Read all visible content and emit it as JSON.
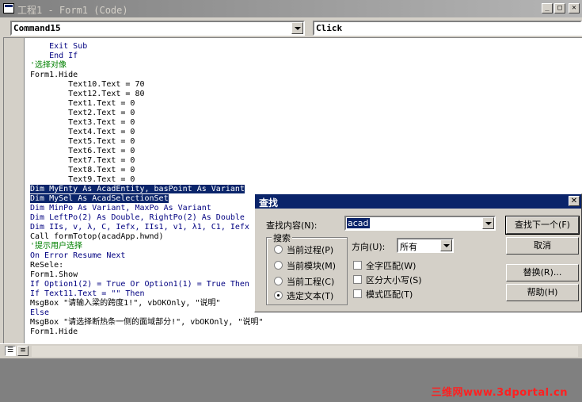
{
  "window": {
    "title": "工程1 - Form1 (Code)",
    "min_icon": "minimize-icon",
    "max_icon": "maximize-icon",
    "close_icon": "close-icon"
  },
  "object_combo": {
    "value": "Command15"
  },
  "proc_combo": {
    "value": "Click"
  },
  "code_lines": [
    {
      "t": "    Exit Sub",
      "c": "kw"
    },
    {
      "t": "    End If",
      "c": "kw"
    },
    {
      "t": "'选择对像",
      "c": "cm"
    },
    {
      "t": "Form1.Hide",
      "c": "tx"
    },
    {
      "t": "        Text10.Text = 70",
      "c": "tx"
    },
    {
      "t": "        Text12.Text = 80",
      "c": "tx"
    },
    {
      "t": "        Text1.Text = 0",
      "c": "tx"
    },
    {
      "t": "        Text2.Text = 0",
      "c": "tx"
    },
    {
      "t": "        Text3.Text = 0",
      "c": "tx"
    },
    {
      "t": "        Text4.Text = 0",
      "c": "tx"
    },
    {
      "t": "        Text5.Text = 0",
      "c": "tx"
    },
    {
      "t": "        Text6.Text = 0",
      "c": "tx"
    },
    {
      "t": "        Text7.Text = 0",
      "c": "tx"
    },
    {
      "t": "        Text8.Text = 0",
      "c": "tx"
    },
    {
      "t": "        Text9.Text = 0",
      "c": "tx"
    },
    {
      "t": "Dim MyEnty As AcadEntity, basPoint As Variant",
      "c": "hl"
    },
    {
      "t": "Dim MySel As AcadSelectionSet",
      "c": "hl"
    },
    {
      "t": "Dim MinPo As Variant, MaxPo As Variant",
      "c": "kw"
    },
    {
      "t": "Dim LeftPo(2) As Double, RightPo(2) As Double",
      "c": "kw"
    },
    {
      "t": "Dim IIs, v, λ, C, Iefx, IIs1, v1, λ1, C1, Iefx",
      "c": "kw"
    },
    {
      "t": "Call formTotop(acadApp.hwnd)",
      "c": "tx"
    },
    {
      "t": "'提示用户选择",
      "c": "cm"
    },
    {
      "t": "On Error Resume Next",
      "c": "kw"
    },
    {
      "t": "ReSele:",
      "c": "tx"
    },
    {
      "t": "Form1.Show",
      "c": "tx"
    },
    {
      "t": "If Option1(2) = True Or Option1(1) = True Then",
      "c": "kw"
    },
    {
      "t": "If Text11.Text = \"\" Then",
      "c": "kw"
    },
    {
      "t": "MsgBox \"请输入梁的跨度1!\", vbOKOnly, \"说明\"",
      "c": "tx"
    },
    {
      "t": "Else",
      "c": "kw"
    },
    {
      "t": "MsgBox \"请选择断热条一侧的面域部分!\", vbOKOnly, \"说明\"",
      "c": "tx"
    },
    {
      "t": "Form1.Hide",
      "c": "tx"
    }
  ],
  "dialog": {
    "title": "查找",
    "find_label": "查找内容(N):",
    "find_value": "acad",
    "direction_label": "方向(U):",
    "direction_value": "所有",
    "search_group": "搜索",
    "radios": [
      "当前过程(P)",
      "当前模块(M)",
      "当前工程(C)",
      "选定文本(T)"
    ],
    "selected_radio": 3,
    "checks": [
      "全字匹配(W)",
      "区分大小写(S)",
      "模式匹配(T)"
    ],
    "buttons": [
      "查找下一个(F)",
      "取消",
      "替换(R)...",
      "帮助(H)"
    ],
    "close": "✕"
  },
  "watermark": "三维网www.3dportal.cn"
}
